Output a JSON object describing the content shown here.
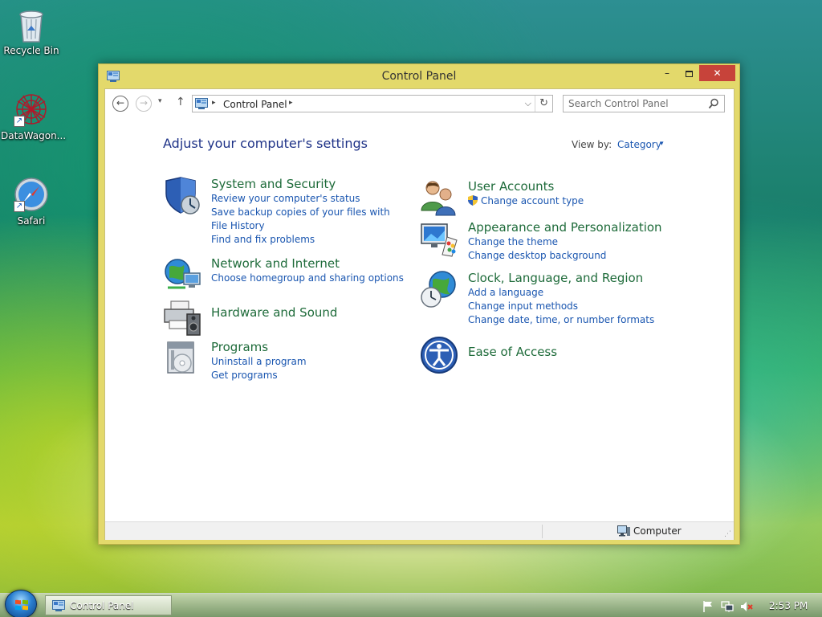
{
  "desktop": {
    "icons": [
      {
        "label": "Recycle Bin"
      },
      {
        "label": "DataWagon..."
      },
      {
        "label": "Safari"
      }
    ]
  },
  "window": {
    "title": "Control Panel",
    "controls": {
      "minimize": "–",
      "close": "✕"
    }
  },
  "navbar": {
    "back": "←",
    "forward": "→",
    "recent": "▾",
    "up": "↑",
    "breadcrumb": "Control Panel",
    "separator": "▸",
    "dropdown": "⌵",
    "refresh": "↻",
    "search_placeholder": "Search Control Panel"
  },
  "main": {
    "heading": "Adjust your computer's settings",
    "view_by_label": "View by:",
    "view_by_value": "Category",
    "view_by_arrow": "▾",
    "categories_left": [
      {
        "title": "System and Security",
        "links": [
          "Review your computer's status",
          "Save backup copies of your files with File History",
          "Find and fix problems"
        ]
      },
      {
        "title": "Network and Internet",
        "links": [
          "Choose homegroup and sharing options"
        ]
      },
      {
        "title": "Hardware and Sound",
        "links": []
      },
      {
        "title": "Programs",
        "links": [
          "Uninstall a program",
          "Get programs"
        ]
      }
    ],
    "categories_right": [
      {
        "title": "User Accounts",
        "links": [
          "Change account type"
        ]
      },
      {
        "title": "Appearance and Personalization",
        "links": [
          "Change the theme",
          "Change desktop background"
        ]
      },
      {
        "title": "Clock, Language, and Region",
        "links": [
          "Add a language",
          "Change input methods",
          "Change date, time, or number formats"
        ]
      },
      {
        "title": "Ease of Access",
        "links": []
      }
    ]
  },
  "statusbar": {
    "location": "Computer",
    "grip": "⋰"
  },
  "taskbar": {
    "window_button": "Control Panel",
    "clock": "2:53 PM"
  },
  "colors": {
    "window_frame": "#e3d96b",
    "close_button": "#c7433a",
    "heading": "#1e3287",
    "category_title": "#1e6b3a",
    "link": "#1a56b0"
  }
}
